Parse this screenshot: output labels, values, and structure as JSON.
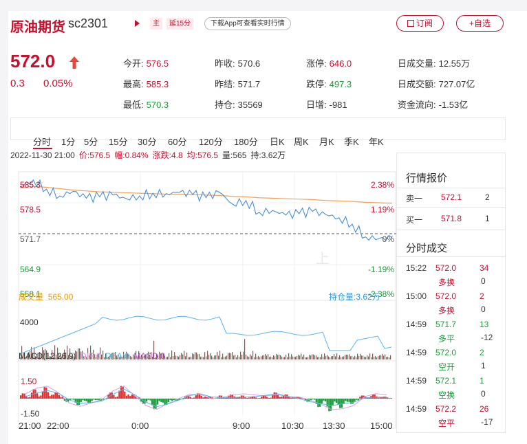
{
  "header": {
    "name": "原油期货",
    "code": "sc2301",
    "tag_main": "主",
    "tag_delay": "延15分",
    "download": "下载App可查看实时行情",
    "subscribe": "订阅",
    "add_fav": "+自选"
  },
  "quote": {
    "price": "572.0",
    "change": "0.3",
    "change_pct": "0.05%",
    "stats": [
      {
        "key": "今开:",
        "val": "576.5",
        "color": "red"
      },
      {
        "key": "昨收:",
        "val": "570.6",
        "color": "normal"
      },
      {
        "key": "涨停:",
        "val": "646.0",
        "color": "red"
      },
      {
        "key": "日成交量:",
        "val": "12.55万",
        "color": "normal"
      },
      {
        "key": "最高:",
        "val": "585.3",
        "color": "red"
      },
      {
        "key": "昨结:",
        "val": "571.7",
        "color": "normal"
      },
      {
        "key": "跌停:",
        "val": "497.3",
        "color": "green"
      },
      {
        "key": "日成交额:",
        "val": "727.07亿",
        "color": "normal"
      },
      {
        "key": "最低:",
        "val": "570.3",
        "color": "green"
      },
      {
        "key": "持仓:",
        "val": "35569",
        "color": "normal"
      },
      {
        "key": "日增:",
        "val": "-981",
        "color": "normal"
      },
      {
        "key": "资金流向:",
        "val": "-1.53亿",
        "color": "normal"
      }
    ]
  },
  "tabs": [
    "分时",
    "1分",
    "5分",
    "15分",
    "30分",
    "60分",
    "120分",
    "180分",
    "日K",
    "周K",
    "月K",
    "季K",
    "年K"
  ],
  "infobar": {
    "datetime": "2022-11-30 21:00",
    "price": "价:576.5",
    "amp": "幅:0.84%",
    "rise": "涨跌:4.8",
    "avg": "均:576.5",
    "vol": "量:565",
    "hold": "持:3.62万"
  },
  "chart_data": {
    "type": "line",
    "y_left": [
      "585.3",
      "578.5",
      "571.7",
      "564.9",
      "558.1"
    ],
    "y_right": [
      "2.38%",
      "1.19%",
      "0%",
      "-1.19%",
      "-2.38%"
    ],
    "x_ticks": [
      "21:00",
      "22:00",
      "0:00",
      "9:00",
      "10:30",
      "13:30",
      "15:00"
    ],
    "ylim": [
      558.1,
      585.3
    ],
    "series": [
      {
        "name": "价",
        "values": [
          582,
          583.5,
          581.5,
          580,
          581,
          579.5,
          579.8,
          580.2,
          579.4,
          580,
          580.6,
          580.5,
          580.8,
          580.3,
          579.6,
          580.8,
          578.2,
          579,
          576.4,
          576.8,
          575.8,
          576.1,
          576.6,
          575.9,
          575.2,
          573.8,
          571,
          570.6,
          570.8
        ]
      },
      {
        "name": "均",
        "values": [
          581.8,
          582.1,
          581.9,
          581.6,
          581.3,
          581.1,
          580.9,
          580.8,
          580.7,
          580.6,
          580.5,
          580.4,
          580.4,
          580.3,
          580.2,
          580.1,
          579.9,
          579.8,
          579.6,
          579.5,
          579.4,
          579.3,
          579.2,
          579.0,
          578.9,
          578.8,
          578.6,
          578.5,
          578.4
        ]
      }
    ],
    "volume_label": "成交量",
    "volume_value": "565.00",
    "volume_tick": "4000",
    "hold_label": "持仓量:3.62万",
    "macd": {
      "label": "MACD(12,26,9)",
      "dif": "DIF:0",
      "dea": "DEA:0",
      "macd": "MACD:0",
      "ticks": [
        "1.50",
        "-1.50"
      ],
      "hist": [
        0.5,
        0.9,
        1.1,
        0.6,
        -0.3,
        -0.6,
        -0.4,
        -0.2,
        0.6,
        1.2,
        0.4,
        -0.5,
        -1.0,
        -0.6,
        -0.2,
        0.3,
        0.5,
        0.2,
        0.3,
        0.4,
        0.3,
        0.2,
        0.3,
        0.6,
        0.4,
        0.2,
        -0.3,
        -0.8,
        -1.2,
        -0.9,
        -0.5,
        0.3,
        0.4,
        0.2
      ]
    }
  },
  "watermark": "上",
  "panel": {
    "quote_title": "行情报价",
    "sell1_label": "卖一",
    "sell1_price": "572.1",
    "sell1_vol": "2",
    "buy1_label": "买一",
    "buy1_price": "571.8",
    "buy1_vol": "1",
    "trades_title": "分时成交",
    "trades": [
      {
        "time": "15:22",
        "price": "572.0",
        "vol": "34",
        "type": "多换",
        "oi": "0",
        "color": "red"
      },
      {
        "time": "15:00",
        "price": "572.0",
        "vol": "2",
        "type": "多换",
        "oi": "0",
        "color": "red"
      },
      {
        "time": "14:59",
        "price": "571.7",
        "vol": "13",
        "type": "多平",
        "oi": "-12",
        "color": "green"
      },
      {
        "time": "14:59",
        "price": "572.0",
        "vol": "2",
        "type": "空开",
        "oi": "1",
        "color": "green"
      },
      {
        "time": "14:59",
        "price": "572.1",
        "vol": "1",
        "type": "空换",
        "oi": "0",
        "color": "green"
      },
      {
        "time": "14:59",
        "price": "572.2",
        "vol": "26",
        "type": "空平",
        "oi": "-17",
        "color": "red"
      }
    ]
  }
}
